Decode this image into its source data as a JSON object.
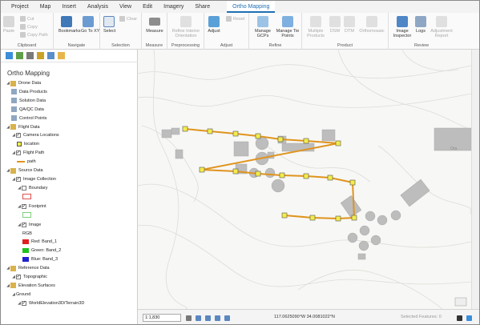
{
  "menu": {
    "tabs": [
      "Project",
      "Map",
      "Insert",
      "Analysis",
      "View",
      "Edit",
      "Imagery",
      "Share",
      "Ortho Mapping"
    ],
    "active_tab": "Ortho Mapping"
  },
  "ribbon": {
    "clipboard": {
      "label": "Clipboard",
      "paste": "Paste",
      "cut": "Cut",
      "copy": "Copy",
      "copy_path": "Copy Path"
    },
    "navigate": {
      "label": "Navigate",
      "bookmarks": "Bookmarks",
      "go_to_xy": "Go To XY"
    },
    "selection": {
      "label": "Selection",
      "select": "Select",
      "clear": "Clear"
    },
    "measure": {
      "label": "Measure",
      "measure": "Measure"
    },
    "preprocessing": {
      "label": "Preprocessing",
      "refine": "Refine Interior Orientation"
    },
    "adjust": {
      "label": "Adjust",
      "adjust": "Adjust",
      "reset": "Reset"
    },
    "refine": {
      "label": "Refine",
      "manage_gcps": "Manage GCPs",
      "manage_tie_points": "Manage Tie Points"
    },
    "product": {
      "label": "Product",
      "multiple_products": "Multiple Products",
      "dsm": "DSM",
      "dtm": "DTM",
      "orthomosaic": "Orthomosaic"
    },
    "review": {
      "label": "Review",
      "image_inspector": "Image Inspector",
      "logs": "Logs",
      "adjustment_report": "Adjustment Report"
    }
  },
  "pane": {
    "title": "Ortho Mapping",
    "tree": [
      {
        "label": "Drone Data",
        "indent": 0,
        "kind": "folder"
      },
      {
        "label": "Data Products",
        "indent": 1,
        "kind": "folder"
      },
      {
        "label": "Solution Data",
        "indent": 1,
        "kind": "folder"
      },
      {
        "label": "QA/QC Data",
        "indent": 1,
        "kind": "folder"
      },
      {
        "label": "Control Points",
        "indent": 1,
        "kind": "folder"
      },
      {
        "label": "Flight Data",
        "indent": 0,
        "kind": "folder"
      },
      {
        "label": "Camera Locations",
        "indent": 1,
        "kind": "layer"
      },
      {
        "label": "location",
        "indent": 2,
        "kind": "legend-point"
      },
      {
        "label": "Flight Path",
        "indent": 1,
        "kind": "layer"
      },
      {
        "label": "path",
        "indent": 2,
        "kind": "legend-line"
      },
      {
        "label": "Source Data",
        "indent": 0,
        "kind": "folder"
      },
      {
        "label": "Image Collection",
        "indent": 1,
        "kind": "layer"
      },
      {
        "label": "Boundary",
        "indent": 2,
        "kind": "layer-off"
      },
      {
        "label": "",
        "indent": 3,
        "kind": "legend-boundary"
      },
      {
        "label": "Footprint",
        "indent": 2,
        "kind": "layer"
      },
      {
        "label": "",
        "indent": 3,
        "kind": "legend-footprint"
      },
      {
        "label": "Image",
        "indent": 2,
        "kind": "layer"
      },
      {
        "label": "RGB",
        "indent": 3,
        "kind": "text"
      },
      {
        "label": "Red:   Band_1",
        "indent": 3,
        "kind": "band-red"
      },
      {
        "label": "Green: Band_2",
        "indent": 3,
        "kind": "band-green"
      },
      {
        "label": "Blue:   Band_3",
        "indent": 3,
        "kind": "band-blue"
      },
      {
        "label": "Reference Data",
        "indent": 0,
        "kind": "folder"
      },
      {
        "label": "Topographic",
        "indent": 1,
        "kind": "layer"
      },
      {
        "label": "Elevation Surfaces",
        "indent": 0,
        "kind": "folder"
      },
      {
        "label": "Ground",
        "indent": 1,
        "kind": "text"
      },
      {
        "label": "WorldElevation3D/Terrain3D",
        "indent": 2,
        "kind": "layer"
      }
    ]
  },
  "status": {
    "scale": "1:1,830",
    "coordinates": "117.0625090°W 34.0081022°N",
    "selected_features": "Selected Features: 0"
  },
  "map_label": "Ora"
}
